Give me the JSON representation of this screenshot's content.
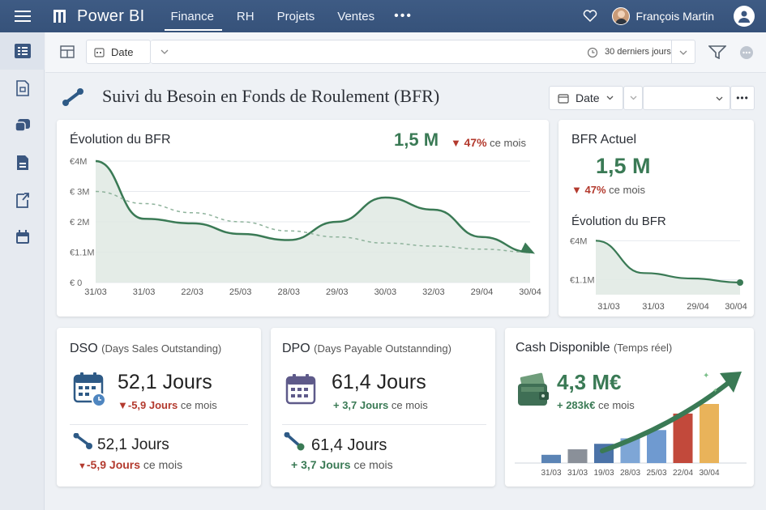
{
  "app": {
    "brand": "Power BI",
    "nav": [
      "Finance",
      "RH",
      "Projets",
      "Ventes"
    ],
    "nav_more": "•••",
    "user_name": "François Martin"
  },
  "toolbar": {
    "date_label": "Date",
    "period_label": "30 derniers jours"
  },
  "page": {
    "title": "Suivi du Besoin en Fonds de Roulement (BFR)",
    "filter_label": "Date",
    "more": "•••"
  },
  "bfr_chart": {
    "title": "Évolution du BFR",
    "kpi_value": "1,5 M",
    "kpi_delta": "47%",
    "kpi_delta_suffix": "ce mois",
    "y_ticks": [
      "€4M",
      "€ 3M",
      "€ 2M",
      "€1.1M",
      "€ 0"
    ],
    "x_ticks": [
      "31/03",
      "31/03",
      "22/03",
      "25/03",
      "28/03",
      "29/03",
      "30/03",
      "32/03",
      "29/04",
      "30/04"
    ]
  },
  "bfr_actuel": {
    "title": "BFR Actuel",
    "value": "1,5 M",
    "delta": "47%",
    "delta_suffix": "ce mois",
    "sub_title": "Évolution du BFR",
    "y_ticks": [
      "€4M",
      "€1.1M"
    ],
    "x_ticks": [
      "31/03",
      "31/03",
      "29/04",
      "30/04"
    ]
  },
  "dso": {
    "title": "DSO",
    "subtitle": "(Days Sales Outstanding)",
    "value": "52,1 Jours",
    "delta": "-5,9 Jours",
    "delta_suffix": "ce mois",
    "value2": "52,1 Jours",
    "delta2": "-5,9 Jours",
    "delta2_suffix": "ce mois"
  },
  "dpo": {
    "title": "DPO",
    "subtitle": "(Days Payable Outstannding)",
    "value": "61,4 Jours",
    "delta": "+ 3,7 Jours",
    "delta_suffix": "ce mois",
    "value2": "61,4 Jours",
    "delta2": "+ 3,7 Jours",
    "delta2_suffix": "ce mois"
  },
  "cash": {
    "title": "Cash Disponible",
    "subtitle": "(Temps réel)",
    "value": "4,3 M€",
    "delta": "+ 283k€",
    "delta_suffix": "ce mois",
    "x_ticks": [
      "31/03",
      "31/03",
      "19/03",
      "28/03",
      "25/03",
      "22/04",
      "30/04"
    ]
  },
  "colors": {
    "topbar": "#3b5780",
    "positive": "#3a7a55",
    "negative": "#b33a2e",
    "area_fill": "#dfe9e3"
  },
  "chart_data": [
    {
      "type": "area",
      "title": "Évolution du BFR",
      "x": [
        "31/03",
        "31/03",
        "22/03",
        "25/03",
        "28/03",
        "29/03",
        "30/03",
        "32/03",
        "29/04",
        "30/04"
      ],
      "series": [
        {
          "values": [
            4.0,
            2.1,
            1.95,
            1.6,
            1.4,
            2.0,
            2.8,
            2.4,
            1.5,
            1.0
          ]
        },
        {
          "values": [
            3.0,
            2.6,
            2.3,
            2.0,
            1.7,
            1.5,
            1.3,
            1.2,
            1.1,
            1.0
          ]
        }
      ],
      "ylim": [
        0,
        4
      ],
      "ylabel": "",
      "xlabel": ""
    },
    {
      "type": "area",
      "title": "Évolution du BFR",
      "x": [
        "31/03",
        "31/03",
        "29/04",
        "30/04"
      ],
      "series": [
        {
          "values": [
            4.0,
            1.6,
            1.2,
            0.9
          ]
        }
      ],
      "ylim": [
        0,
        4.5
      ]
    },
    {
      "type": "bar",
      "title": "Cash Disponible",
      "categories": [
        "31/03",
        "31/03",
        "19/03",
        "28/03",
        "25/03",
        "22/04",
        "30/04"
      ],
      "values": [
        0.6,
        1.0,
        1.4,
        1.8,
        2.4,
        3.6,
        4.3
      ],
      "bar_colors": [
        "#5b84b5",
        "#8a9099",
        "#4b73a8",
        "#7ea6d6",
        "#6f9ad0",
        "#c2493b",
        "#e9b35a"
      ]
    }
  ]
}
